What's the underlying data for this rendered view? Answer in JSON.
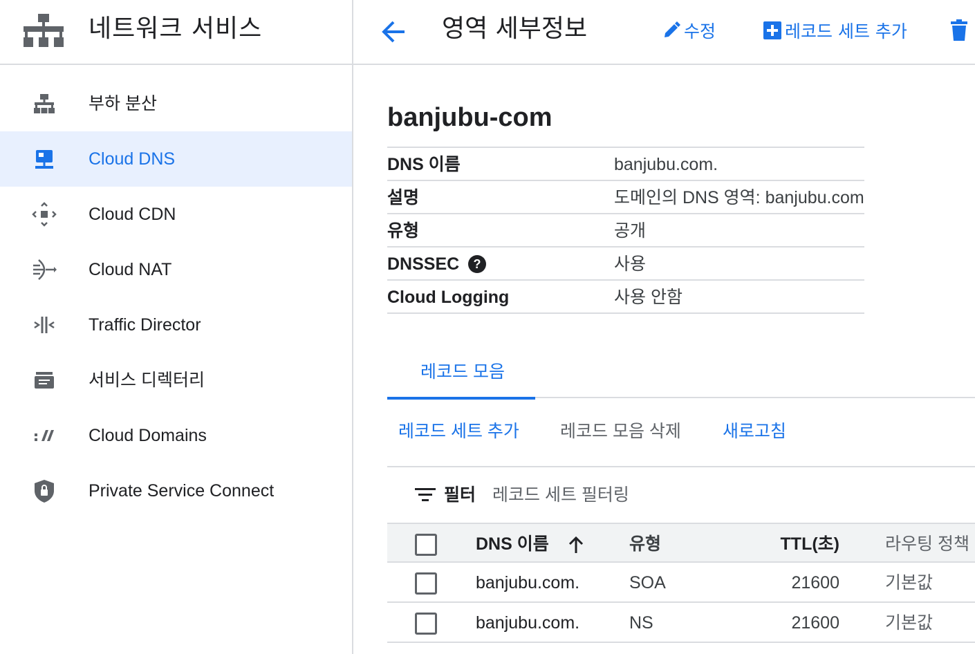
{
  "sidebar": {
    "product_title": "네트워크 서비스",
    "items": [
      {
        "label": "부하 분산",
        "icon": "load-balancing-icon"
      },
      {
        "label": "Cloud DNS",
        "icon": "cloud-dns-icon",
        "active": true
      },
      {
        "label": "Cloud CDN",
        "icon": "cloud-cdn-icon"
      },
      {
        "label": "Cloud NAT",
        "icon": "cloud-nat-icon"
      },
      {
        "label": "Traffic Director",
        "icon": "traffic-director-icon"
      },
      {
        "label": "서비스 디렉터리",
        "icon": "service-directory-icon"
      },
      {
        "label": "Cloud Domains",
        "icon": "cloud-domains-icon"
      },
      {
        "label": "Private Service Connect",
        "icon": "private-service-connect-icon"
      }
    ]
  },
  "header": {
    "title": "영역 세부정보",
    "actions": {
      "edit": "수정",
      "add_record_set": "레코드 세트 추가"
    }
  },
  "zone": {
    "name": "banjubu-com",
    "details": [
      {
        "key": "DNS 이름",
        "value": "banjubu.com."
      },
      {
        "key": "설명",
        "value": "도메인의 DNS 영역: banjubu.com"
      },
      {
        "key": "유형",
        "value": "공개"
      },
      {
        "key": "DNSSEC",
        "value": "사용",
        "help": true
      },
      {
        "key": "Cloud Logging",
        "value": "사용 안함"
      }
    ]
  },
  "tabs": [
    {
      "label": "레코드 모음",
      "active": true
    }
  ],
  "toolbar": {
    "add_record_set": "레코드 세트 추가",
    "delete_records": "레코드 모음 삭제",
    "refresh": "새로고침"
  },
  "filter": {
    "label": "필터",
    "placeholder": "레코드 세트 필터링"
  },
  "records": {
    "columns": {
      "dns_name": "DNS 이름",
      "type": "유형",
      "ttl": "TTL(초)",
      "routing_policy": "라우팅 정책"
    },
    "rows": [
      {
        "dns_name": "banjubu.com.",
        "type": "SOA",
        "ttl": "21600",
        "routing_policy": "기본값"
      },
      {
        "dns_name": "banjubu.com.",
        "type": "NS",
        "ttl": "21600",
        "routing_policy": "기본값"
      }
    ]
  },
  "colors": {
    "accent": "#1a73e8",
    "active_bg": "#e8f0fe",
    "icon_gray": "#5f6368",
    "divider": "#dadce0"
  }
}
